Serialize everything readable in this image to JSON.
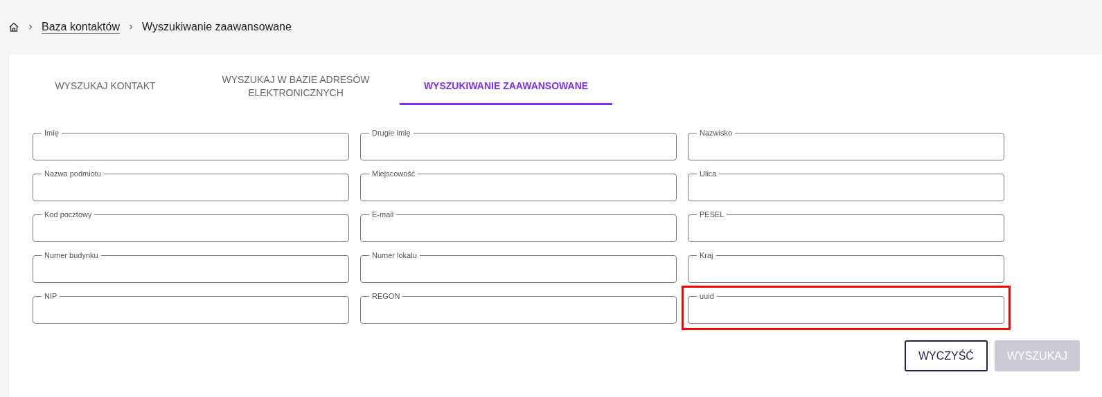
{
  "breadcrumb": [
    {
      "label": "Baza kontaktów",
      "link": true
    },
    {
      "label": "Wyszukiwanie zaawansowane",
      "link": false
    }
  ],
  "tabs": [
    {
      "label": "WYSZUKAJ KONTAKT",
      "selected": false
    },
    {
      "label": "WYSZUKAJ W BAZIE ADRESÓW ELEKTRONICZNYCH",
      "selected": false
    },
    {
      "label": "WYSZUKIWANIE ZAAWANSOWANE",
      "selected": true
    }
  ],
  "fields": [
    {
      "label": "Imię",
      "highlighted": false
    },
    {
      "label": "Drugie imię",
      "highlighted": false
    },
    {
      "label": "Nazwisko",
      "highlighted": false
    },
    {
      "label": "Nazwa podmiotu",
      "highlighted": false
    },
    {
      "label": "Miejscowość",
      "highlighted": false
    },
    {
      "label": "Ulica",
      "highlighted": false
    },
    {
      "label": "Kod pocztowy",
      "highlighted": false
    },
    {
      "label": "E-mail",
      "highlighted": false
    },
    {
      "label": "PESEL",
      "highlighted": false
    },
    {
      "label": "Numer budynku",
      "highlighted": false
    },
    {
      "label": "Numer lokalu",
      "highlighted": false
    },
    {
      "label": "Kraj",
      "highlighted": false
    },
    {
      "label": "NIP",
      "highlighted": false
    },
    {
      "label": "REGON",
      "highlighted": false
    },
    {
      "label": "uuid",
      "highlighted": true
    }
  ],
  "buttons": [
    {
      "label": "WYCZYŚĆ",
      "kind": "outline",
      "disabled": false
    },
    {
      "label": "WYSZUKAJ",
      "kind": "filled",
      "disabled": true
    }
  ]
}
